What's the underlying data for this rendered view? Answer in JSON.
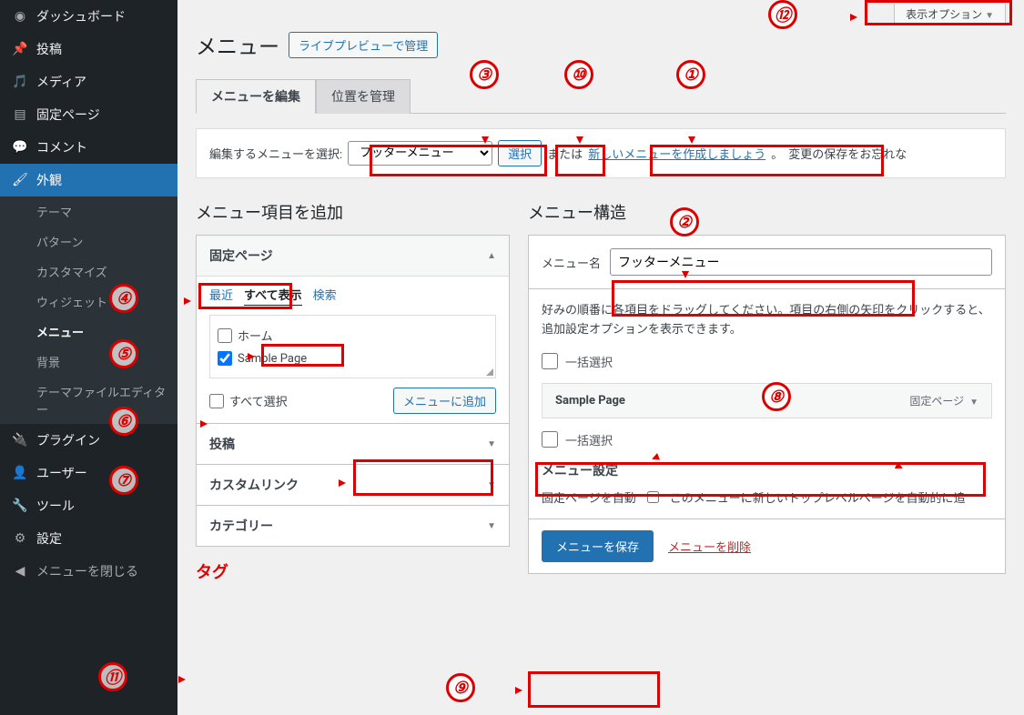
{
  "sidebar": {
    "items": [
      {
        "icon": "dashboard",
        "label": "ダッシュボード"
      },
      {
        "icon": "pin",
        "label": "投稿"
      },
      {
        "icon": "media",
        "label": "メディア"
      },
      {
        "icon": "page",
        "label": "固定ページ"
      },
      {
        "icon": "comment",
        "label": "コメント"
      },
      {
        "icon": "brush",
        "label": "外観",
        "active": true
      },
      {
        "icon": "plugin",
        "label": "プラグイン"
      },
      {
        "icon": "user",
        "label": "ユーザー"
      },
      {
        "icon": "tool",
        "label": "ツール"
      },
      {
        "icon": "settings",
        "label": "設定"
      },
      {
        "icon": "collapse",
        "label": "メニューを閉じる"
      }
    ],
    "submenu": [
      {
        "label": "テーマ"
      },
      {
        "label": "パターン"
      },
      {
        "label": "カスタマイズ"
      },
      {
        "label": "ウィジェット"
      },
      {
        "label": "メニュー",
        "active": true
      },
      {
        "label": "背景"
      },
      {
        "label": "テーマファイルエディター"
      }
    ]
  },
  "header": {
    "screen_options": "表示オプション",
    "title": "メニュー",
    "live_preview": "ライブプレビューで管理"
  },
  "tabs": {
    "edit": "メニューを編集",
    "locations": "位置を管理"
  },
  "select_bar": {
    "label": "編集するメニューを選択:",
    "option": "フッターメニュー",
    "select_btn": "選択",
    "or": "または",
    "create_link": "新しいメニューを作成しましょう",
    "period": "。",
    "reminder": "変更の保存をお忘れな"
  },
  "left": {
    "title": "メニュー項目を追加",
    "panels": {
      "pages": "固定ページ",
      "posts": "投稿",
      "links": "カスタムリンク",
      "categories": "カテゴリー"
    },
    "tabs": {
      "recent": "最近",
      "all": "すべて表示",
      "search": "検索"
    },
    "items": {
      "home": "ホーム",
      "sample": "Sample Page"
    },
    "select_all": "すべて選択",
    "add_btn": "メニューに追加"
  },
  "right": {
    "title": "メニュー構造",
    "name_label": "メニュー名",
    "name_value": "フッターメニュー",
    "instructions": "好みの順番に各項目をドラッグしてください。項目の右側の矢印をクリックすると、追加設定オプションを表示できます。",
    "bulk": "一括選択",
    "item": {
      "title": "Sample Page",
      "type": "固定ページ"
    },
    "settings_title": "メニュー設定",
    "auto_label": "固定ページを自動",
    "auto_desc": "このメニューに新しいトップレベルページを自動的に追",
    "save": "メニューを保存",
    "delete": "メニューを削除"
  },
  "tag_label": "タグ"
}
